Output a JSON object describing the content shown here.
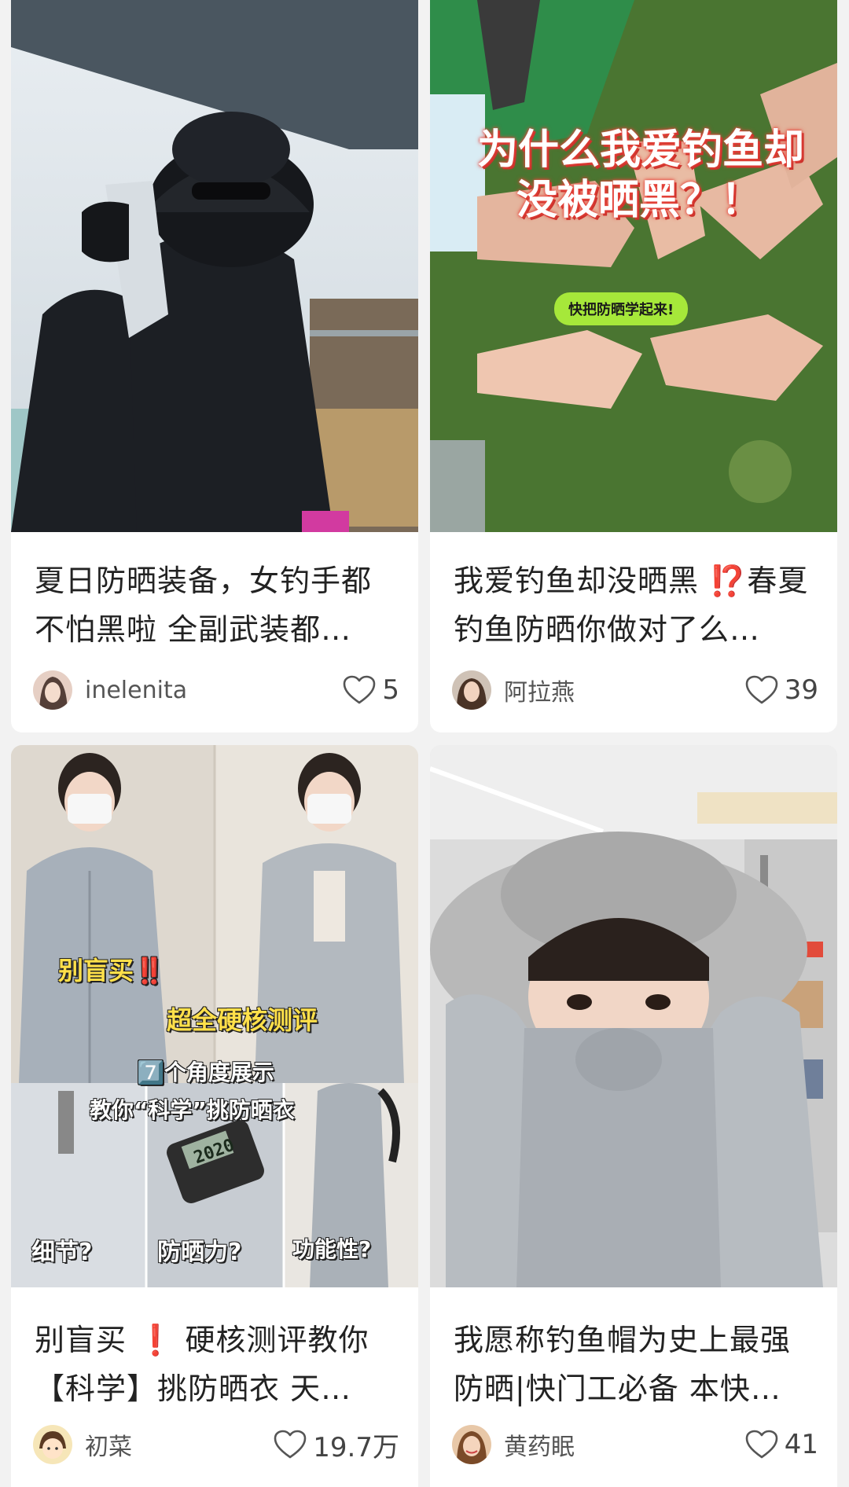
{
  "cards": [
    {
      "title": "夏日防晒装备，女钓手都不怕黑啦 全副武装都…",
      "author": "inelenita",
      "likes": "5"
    },
    {
      "title": "我爱钓鱼却没晒黑 ⁉️春夏钓鱼防晒你做对了么…",
      "author": "阿拉燕",
      "likes": "39",
      "cover_text": {
        "headline_1": "为什么我爱钓鱼却",
        "headline_2": "没被晒黑？！",
        "bubble": "快把防晒学起来!"
      }
    },
    {
      "title": "别盲买 ❗ 硬核测评教你【科学】挑防晒衣 天…",
      "author": "初菜",
      "likes": "19.7万",
      "cover_text": {
        "tag_1": "别盲买‼️",
        "tag_2": "超全硬核测评",
        "tag_3": "7️⃣个角度展示",
        "tag_4": "教你“科学”挑防晒衣",
        "label_1": "细节?",
        "label_2": "防晒力?",
        "label_3": "功能性?",
        "device_reading": "2020"
      }
    },
    {
      "title": "我愿称钓鱼帽为史上最强防晒|快门工必备 本快…",
      "author": "黄药眠",
      "likes": "41"
    }
  ],
  "icons": {
    "like": "heart-outline-icon"
  },
  "colors": {
    "card_bg": "#ffffff",
    "feed_bg": "#f2f2f2",
    "bubble_green": "#a6e83a",
    "tag_yellow": "#ffe04a",
    "headline_red": "#e8453c"
  }
}
